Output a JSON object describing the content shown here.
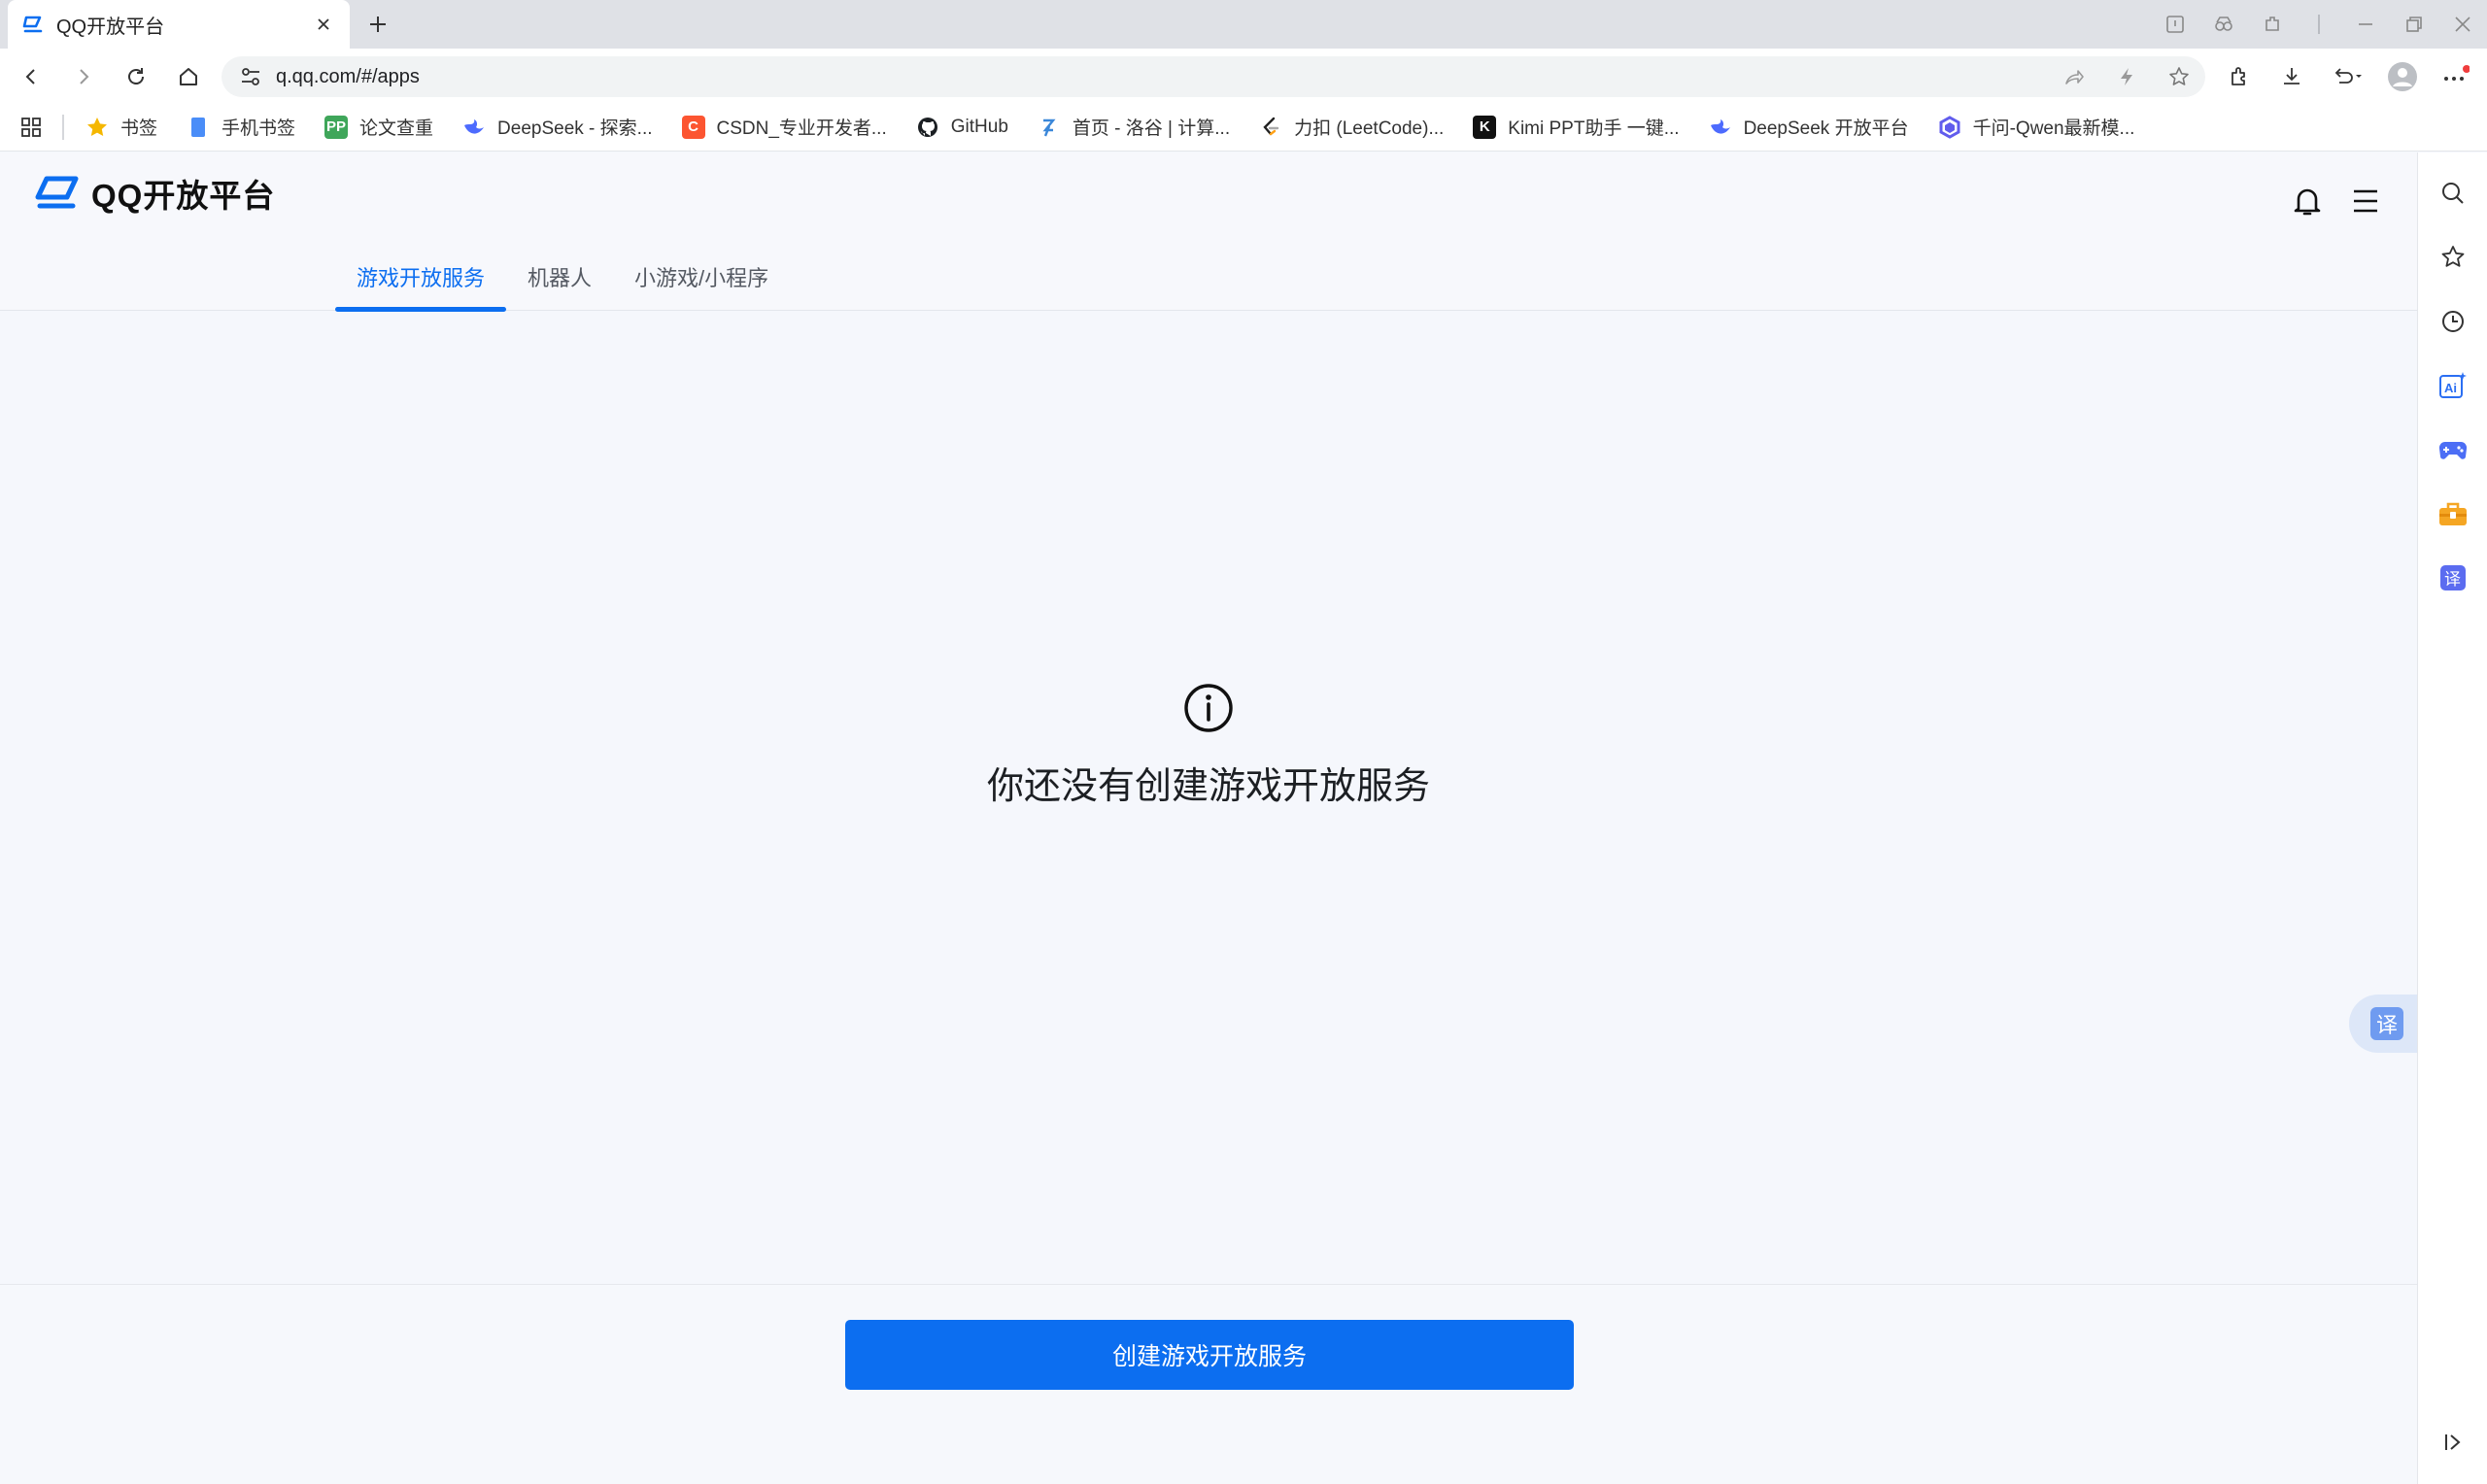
{
  "browser": {
    "tab": {
      "title": "QQ开放平台",
      "favicon": "qq-open-platform-icon"
    },
    "new_tab_icon": "plus-icon",
    "window_controls": [
      "tab-search-icon",
      "copilot-icon",
      "extensions-icon",
      "minimize-icon",
      "restore-icon",
      "close-icon"
    ],
    "address": {
      "url": "q.qq.com/#/apps"
    },
    "omnibox_icons": [
      "share-icon",
      "lightning-icon",
      "star-icon"
    ],
    "toolbar_icons": [
      "extension-puzzle-icon",
      "download-icon",
      "undo-icon",
      "profile-icon",
      "more-icon"
    ],
    "bookmarks": [
      {
        "label": "书签",
        "icon": "star-icon",
        "color": "#f5b700"
      },
      {
        "label": "手机书签",
        "icon": "phone-icon",
        "color": "#4a8df8"
      },
      {
        "label": "论文查重",
        "icon": "pp-icon",
        "color": "#3fa65a",
        "glyph": "PP"
      },
      {
        "label": "DeepSeek - 探索...",
        "icon": "deepseek-icon",
        "color": "#4d6bfe"
      },
      {
        "label": "CSDN_专业开发者...",
        "icon": "csdn-icon",
        "color": "#fc5531",
        "glyph": "C"
      },
      {
        "label": "GitHub",
        "icon": "github-icon",
        "color": "#1b1f23"
      },
      {
        "label": "首页 - 洛谷 | 计算...",
        "icon": "luogu-icon",
        "color": "#3a87d9"
      },
      {
        "label": "力扣 (LeetCode)...",
        "icon": "leetcode-icon",
        "color": "#ffa116"
      },
      {
        "label": "Kimi PPT助手 一键...",
        "icon": "kimi-icon",
        "color": "#111111",
        "glyph": "K"
      },
      {
        "label": "DeepSeek 开放平台",
        "icon": "deepseek-icon",
        "color": "#4d6bfe"
      },
      {
        "label": "千问-Qwen最新模...",
        "icon": "qwen-icon",
        "color": "#615ced"
      }
    ]
  },
  "sidebar": {
    "items": [
      "search-icon",
      "favorites-icon",
      "history-icon",
      "ai-icon",
      "game-icon",
      "toolbox-icon",
      "translate-icon"
    ],
    "collapse_icon": "collapse-icon"
  },
  "page": {
    "logo_text": "QQ开放平台",
    "header_icons": [
      "bell-icon",
      "menu-icon"
    ],
    "tabs": [
      {
        "label": "游戏开放服务",
        "active": true
      },
      {
        "label": "机器人",
        "active": false
      },
      {
        "label": "小游戏/小程序",
        "active": false
      }
    ],
    "empty_state": {
      "icon": "info-icon",
      "message": "你还没有创建游戏开放服务"
    },
    "create_button": "创建游戏开放服务",
    "translate_float": {
      "glyph": "译"
    },
    "colors": {
      "accent": "#0c6ef0",
      "background": "#f5f7fc"
    }
  }
}
